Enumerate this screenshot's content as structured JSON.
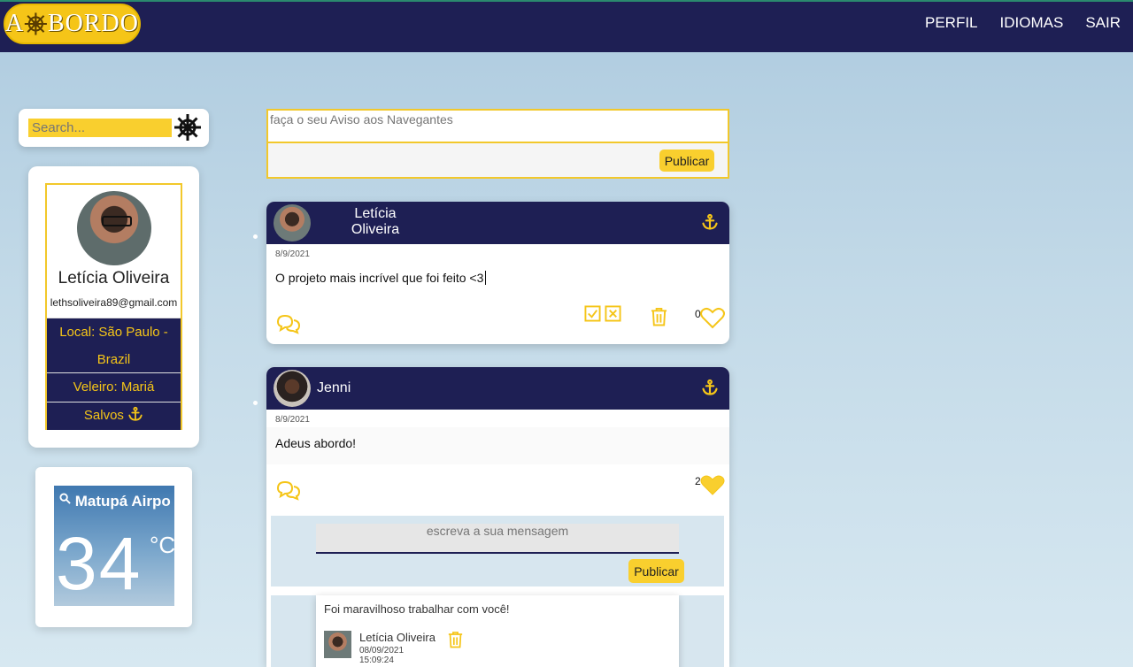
{
  "brand": {
    "logo_text_a": "A",
    "logo_text_b": "BORDO"
  },
  "nav": {
    "profile": "PERFIL",
    "languages": "IDIOMAS",
    "logout": "SAIR"
  },
  "search": {
    "placeholder": "Search..."
  },
  "profile": {
    "name": "Letícia Oliveira",
    "email": "lethsoliveira89@gmail.com",
    "local": "Local: São Paulo - Brazil",
    "boat": "Veleiro: Mariá",
    "saved": "Salvos"
  },
  "weather": {
    "city": "Matupá Airpo",
    "temp": "34",
    "unit": "°C"
  },
  "composer": {
    "placeholder": "faça o seu Aviso aos Navegantes",
    "submit": "Publicar"
  },
  "posts": [
    {
      "author_line1": "Letícia",
      "author_line2": "Oliveira",
      "date": "8/9/2021",
      "text": "O projeto mais incrível que foi feito <3",
      "likes": "0"
    },
    {
      "author": "Jenni",
      "date": "8/9/2021",
      "text": "Adeus abordo!",
      "likes": "2",
      "reply_placeholder": "escreva a sua mensagem",
      "reply_submit": "Publicar",
      "comment": {
        "text": "Foi maravilhoso trabalhar com você!",
        "author": "Letícia Oliveira",
        "date": "08/09/2021",
        "time": "15:09:24"
      }
    }
  ],
  "colors": {
    "navy": "#1e1f54",
    "accent": "#f9cf2e",
    "border_gold": "#f2c82b"
  },
  "icons": [
    "ship-wheel-icon",
    "anchor-icon",
    "chat-bubbles-icon",
    "edit-check-icon",
    "edit-cancel-icon",
    "trash-icon",
    "heart-icon"
  ]
}
